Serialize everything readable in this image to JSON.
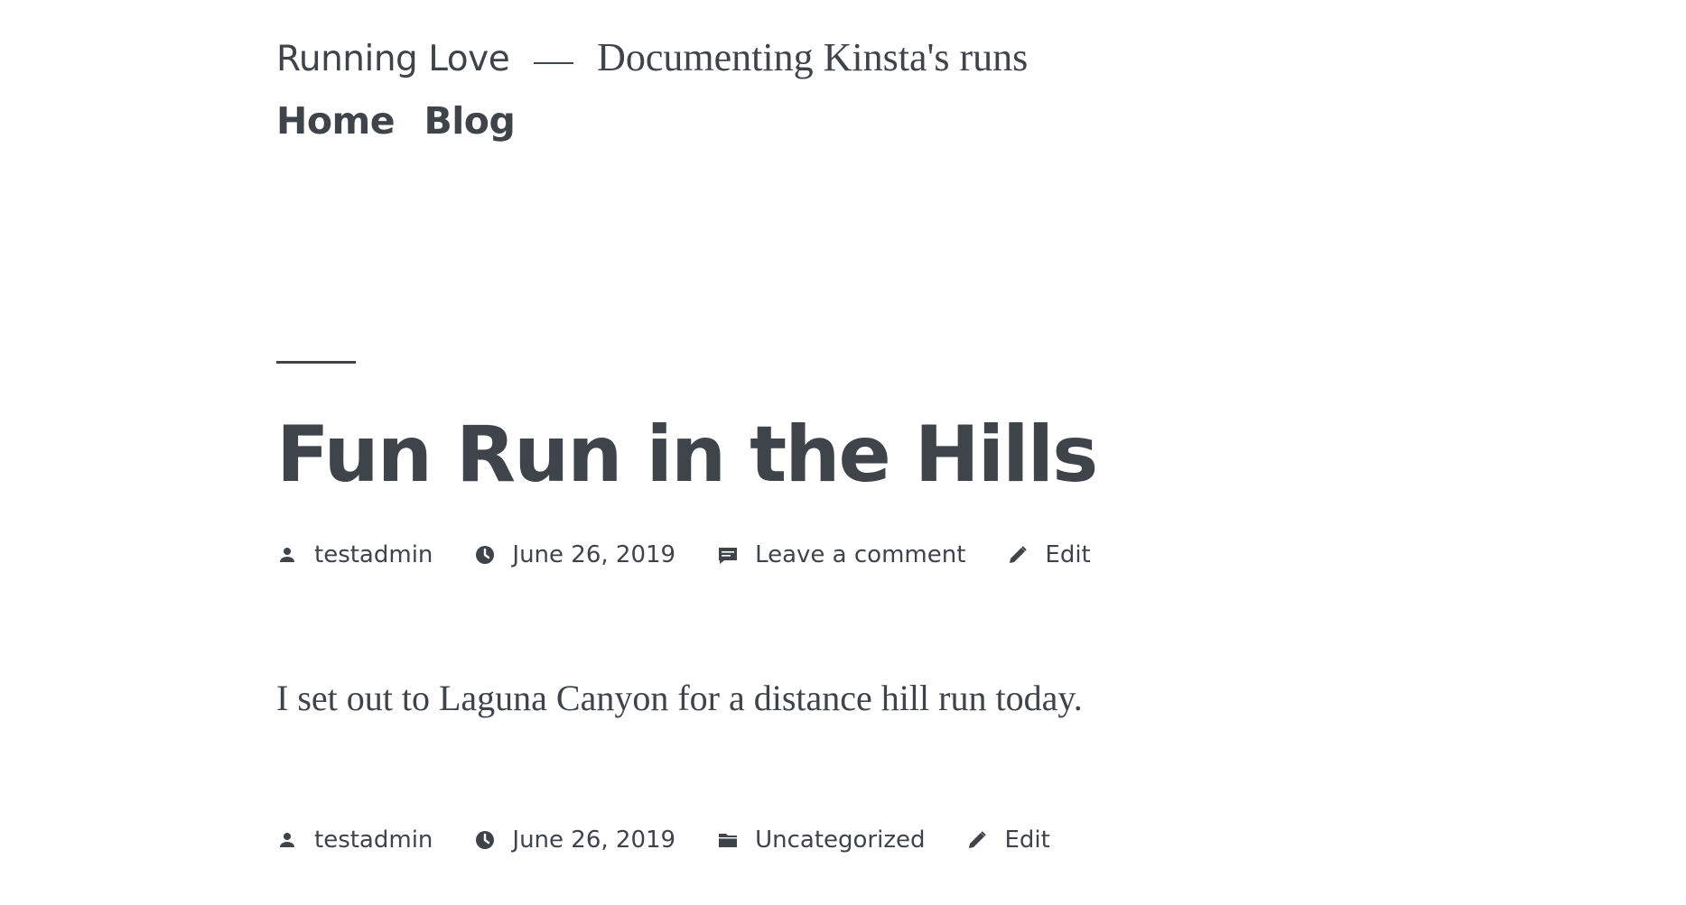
{
  "header": {
    "site_title": "Running Love",
    "separator": "—",
    "tagline": "Documenting Kinsta's runs",
    "nav": [
      "Home",
      "Blog"
    ]
  },
  "post": {
    "title": "Fun Run in the Hills",
    "meta_top": {
      "author": "testadmin",
      "date": "June 26, 2019",
      "comments": "Leave a comment",
      "edit": "Edit"
    },
    "content": "I set out to Laguna Canyon for a distance hill run today.",
    "meta_bottom": {
      "author": "testadmin",
      "date": "June 26, 2019",
      "category": "Uncategorized",
      "edit": "Edit"
    }
  },
  "icons": {
    "author": "person-icon",
    "date": "clock-icon",
    "comments": "comment-icon",
    "category": "folder-icon",
    "edit": "pencil-icon"
  },
  "colors": {
    "text": "#3f434a",
    "background": "#ffffff"
  }
}
